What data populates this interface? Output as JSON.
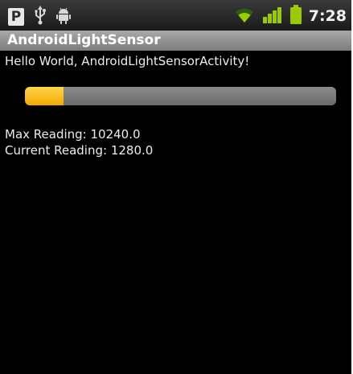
{
  "status_bar": {
    "icons": [
      "p-notification-icon",
      "usb-icon",
      "android-debug-icon",
      "wifi-icon",
      "signal-icon",
      "battery-icon"
    ],
    "time": "7:28"
  },
  "app": {
    "title": "AndroidLightSensor",
    "hello_text": "Hello World, AndroidLightSensorActivity!"
  },
  "sensor": {
    "progress_fraction": 0.125,
    "max_reading_text": "Max Reading: 10240.0",
    "current_reading_text": "Current Reading: 1280.0"
  },
  "colors": {
    "background": "#000000",
    "progress_fill": "#f6b700",
    "progress_track": "#7a7a7a",
    "signal_green": "#99cc00"
  }
}
